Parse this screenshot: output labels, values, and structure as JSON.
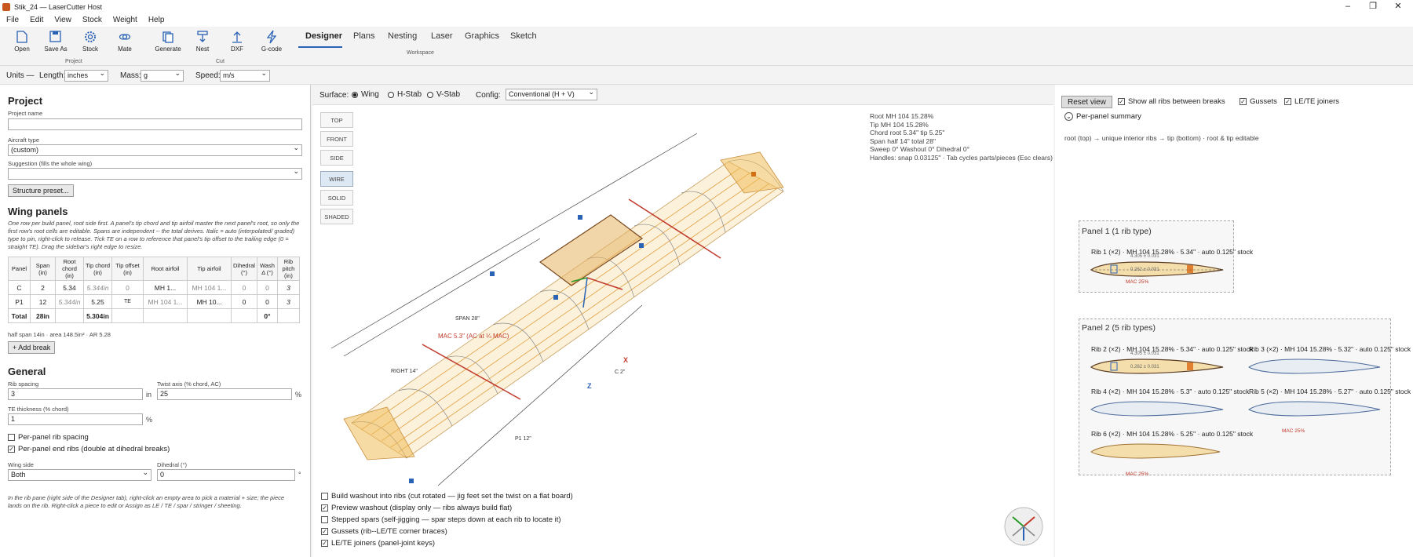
{
  "window": {
    "title": "Stik_24 — LaserCutter Host"
  },
  "menu": [
    "File",
    "Edit",
    "View",
    "Stock",
    "Weight",
    "Help"
  ],
  "ribbon": {
    "buttons": [
      {
        "label": "Open",
        "icon": "open-file-icon"
      },
      {
        "label": "Save As",
        "icon": "save-icon"
      },
      {
        "label": "Stock",
        "icon": "gear-icon"
      },
      {
        "label": "Mate",
        "icon": "link-icon"
      },
      {
        "label": "Generate",
        "icon": "copy-icon"
      },
      {
        "label": "Nest",
        "icon": "nest-icon"
      },
      {
        "label": "DXF",
        "icon": "export-icon"
      },
      {
        "label": "G-code",
        "icon": "bolt-icon"
      }
    ],
    "groups": [
      "Project",
      "Cut",
      "Workspace"
    ],
    "tabs": [
      "Designer",
      "Plans",
      "Nesting",
      "Laser",
      "Graphics",
      "Sketch"
    ],
    "active_tab": "Designer"
  },
  "units": {
    "label": "Units —",
    "length_label": "Length:",
    "length": "inches",
    "mass_label": "Mass:",
    "mass": "g",
    "speed_label": "Speed:",
    "speed": "m/s"
  },
  "project": {
    "heading": "Project",
    "name_label": "Project name",
    "name": "",
    "aircraft_label": "Aircraft type",
    "aircraft": "(custom)",
    "suggestion_label": "Suggestion (fills the whole wing)",
    "suggestion": "",
    "preset_button": "Structure preset..."
  },
  "wing": {
    "heading": "Wing panels",
    "help": "One row per build panel, root side first. A panel's tip chord and tip airfoil master the next panel's root, so only the first row's root cells are editable. Spans are independent -- the total derives. Italic = auto (interpolated/ graded) type to pin, right-click to release. Tick TE on a row to reference that panel's tip offset to the trailing edge (0 = straight TE). Drag the sidebar's right edge to resize.",
    "columns": [
      "Panel",
      "Span (in)",
      "Root chord (in)",
      "Tip chord (in)",
      "Tip offset (in)",
      "Root airfoil",
      "Tip airfoil",
      "Dihedral (°)",
      "Wash Δ (°)",
      "Rib pitch (in)"
    ],
    "rows": [
      {
        "panel": "C",
        "span": "2",
        "root": "5.34",
        "tip": "5.344in",
        "offset": "0",
        "root_af": "MH 1...",
        "tip_af": "MH 104 1...",
        "dihedral": "0",
        "wash": "0",
        "pitch": "3"
      },
      {
        "panel": "P1",
        "span": "12",
        "root": "5.344in",
        "tip": "5.25",
        "offset": "TE",
        "root_af": "MH 104 1...",
        "tip_af": "MH 10...",
        "dihedral": "0",
        "wash": "0",
        "pitch": "3"
      }
    ],
    "total": {
      "label": "Total",
      "span": "28in",
      "tip": "5.304in",
      "wash": "0°"
    },
    "summary": "half span 14in  ·  area 148.5in²  ·  AR 5.28",
    "add_break": "+ Add break"
  },
  "general": {
    "heading": "General",
    "rib_spacing_label": "Rib spacing",
    "rib_spacing": "3",
    "rib_unit": "in",
    "twist_label": "Twist axis (% chord, AC)",
    "twist": "25",
    "twist_unit": "%",
    "te_label": "TE thickness (% chord)",
    "te": "1",
    "te_unit": "%",
    "per_panel_spacing": "Per-panel rib spacing",
    "per_panel_end": "Per-panel end ribs (double at dihedral breaks)",
    "wing_side_label": "Wing side",
    "wing_side": "Both",
    "dihedral_label": "Dihedral (°)",
    "dihedral": "0",
    "dihedral_unit": "°",
    "note": "In the rib pane (right side of the Designer tab), right-click an empty area to pick a material + size; the piece lands on the rib. Right-click a piece to edit or Assign as LE / TE / spar / stringer / sheeting."
  },
  "surface": {
    "label": "Surface:",
    "options": [
      "Wing",
      "H-Stab",
      "V-Stab"
    ],
    "selected": "Wing",
    "config_label": "Config:",
    "config": "Conventional (H + V)"
  },
  "views": [
    "TOP",
    "FRONT",
    "SIDE",
    "WIRE",
    "SOLID",
    "SHADED"
  ],
  "active_view": "WIRE",
  "readout": [
    "Root  MH 104  15.28%",
    "Tip   MH 104  15.28%",
    "Chord  root 5.34\"  tip 5.25\"",
    "Span   half 14\"  total 28\"",
    "Sweep 0°   Washout 0°   Dihedral 0°",
    "Handles: snap 0.03125\"  · Tab cycles parts/pieces (Esc clears)"
  ],
  "dims": {
    "span": "SPAN 28\"",
    "right": "RIGHT 14\"",
    "p1": "P1 12\"",
    "c": "C 2\"",
    "mac": "MAC 5.3\"  (AC at ¼ MAC)",
    "x": "X",
    "z": "Z"
  },
  "options": [
    {
      "label": "Build washout into ribs (cut rotated — jig feet set the twist on a flat board)",
      "checked": false
    },
    {
      "label": "Preview washout (display only — ribs always build flat)",
      "checked": true
    },
    {
      "label": "Stepped spars (self-jigging — spar steps down at each rib to locate it)",
      "checked": false
    },
    {
      "label": "Gussets (rib--LE/TE corner braces)",
      "checked": true
    },
    {
      "label": "LE/TE joiners (panel-joint keys)",
      "checked": true
    }
  ],
  "ribpane": {
    "reset": "Reset view",
    "show_all": "Show all ribs between breaks",
    "gussets": "Gussets",
    "joiners": "LE/TE joiners",
    "summary": "Per-panel summary",
    "hint": "root (top) → unique interior ribs → tip (bottom)  ·  root & tip editable",
    "panel1": "Panel 1   (1 rib type)",
    "panel2": "Panel 2   (5 rib types)",
    "ribs": [
      "Rib 1  (×2)  · MH 104  15.28%  · 5.34\"  · auto 0.125\" stock",
      "Rib 2  (×2)  · MH 104  15.28%  · 5.34\"  · auto 0.125\" stock",
      "Rib 3  (×2)  · MH 104  15.28%  · 5.32\"  · auto 0.125\" stock",
      "Rib 4  (×2)  · MH 104  15.28%  · 5.3\"  · auto 0.125\" stock",
      "Rib 5  (×2)  · MH 104  15.28%  · 5.27\"  · auto 0.125\" stock",
      "Rib 6  (×2)  · MH 104  15.28%  · 5.25\"  · auto 0.125\" stock"
    ],
    "mac": "MAC 25%",
    "dim1": "4.305 ± 0.031",
    "dim2": "0.262 ± 0.031"
  }
}
